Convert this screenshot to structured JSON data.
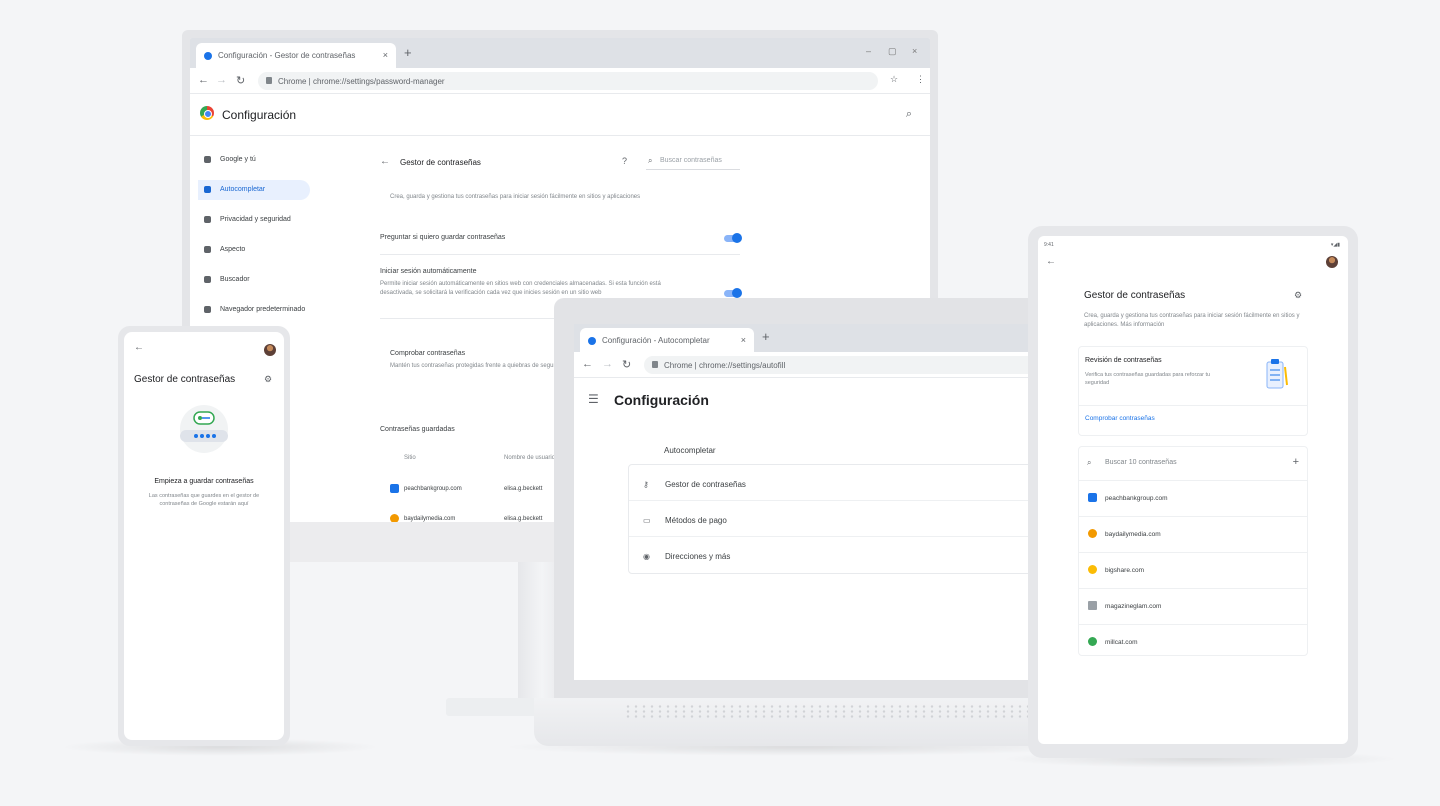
{
  "monitor": {
    "tab_title": "Configuración - Gestor de contraseñas",
    "tab_close": "×",
    "new_tab": "+",
    "win_min": "–",
    "win_max": "▢",
    "win_close": "×",
    "omnibox_text": "Chrome | chrome://settings/password-manager",
    "settings_title": "Configuración",
    "sidebar": [
      {
        "label": "Google y tú"
      },
      {
        "label": "Autocompletar"
      },
      {
        "label": "Privacidad y seguridad"
      },
      {
        "label": "Aspecto"
      },
      {
        "label": "Buscador"
      },
      {
        "label": "Navegador predeterminado"
      }
    ],
    "pm": {
      "title": "Gestor de contraseñas",
      "search_placeholder": "Buscar contraseñas",
      "description": "Crea, guarda y gestiona tus contraseñas para iniciar sesión fácilmente en sitios y aplicaciones",
      "offer_label": "Preguntar si quiero guardar contraseñas",
      "autosignin_label": "Iniciar sesión automáticamente",
      "autosignin_desc": "Permite iniciar sesión automáticamente en sitios web con credenciales almacenadas. Si esta función está desactivada, se solicitará la verificación cada vez que inicies sesión en un sitio web",
      "check_label": "Comprobar contraseñas",
      "check_desc": "Mantén tus contraseñas protegidas frente a quiebras de seguridad",
      "saved_label": "Contraseñas guardadas",
      "col_site": "Sitio",
      "col_user": "Nombre de usuario",
      "saved": [
        {
          "site": "peachbankgroup.com",
          "user": "elisa.g.beckett",
          "color": "#1a73e8"
        },
        {
          "site": "baydailymedia.com",
          "user": "elisa.g.beckett",
          "color": "#f29900"
        }
      ]
    }
  },
  "phone": {
    "title": "Gestor de contraseñas",
    "empty_title": "Empieza a guardar contraseñas",
    "empty_desc": "Las contraseñas que guardes en el gestor de contraseñas de Google estarán aquí"
  },
  "laptop": {
    "tab_title": "Configuración - Autocompletar",
    "tab_close": "×",
    "new_tab": "+",
    "omnibox_text": "Chrome | chrome://settings/autofill",
    "title": "Configuración",
    "section": "Autocompletar",
    "rows": [
      {
        "label": "Gestor de contraseñas",
        "icon": "⚷"
      },
      {
        "label": "Métodos de pago",
        "icon": "▭"
      },
      {
        "label": "Direcciones y más",
        "icon": "◉"
      }
    ]
  },
  "tablet": {
    "status_time": "9:41",
    "status_icons": "▾◢▮",
    "title": "Gestor de contraseñas",
    "description": "Crea, guarda y gestiona tus contraseñas para iniciar sesión fácilmente en sitios y aplicaciones. Más información",
    "review_title": "Revisión de contraseñas",
    "review_desc": "Verifica tus contraseñas guardadas para reforzar tu seguridad",
    "review_link": "Comprobar contraseñas",
    "search_placeholder": "Buscar 10 contraseñas",
    "items": [
      {
        "site": "peachbankgroup.com",
        "color": "#1a73e8"
      },
      {
        "site": "baydailymedia.com",
        "color": "#f29900"
      },
      {
        "site": "bigshare.com",
        "color": "#fbbc05"
      },
      {
        "site": "magazineglam.com",
        "color": "#5f6368"
      },
      {
        "site": "millcat.com",
        "color": "#34a853"
      }
    ]
  },
  "colors": {
    "accent": "#1a73e8",
    "active_bg": "#e8f0fe"
  }
}
